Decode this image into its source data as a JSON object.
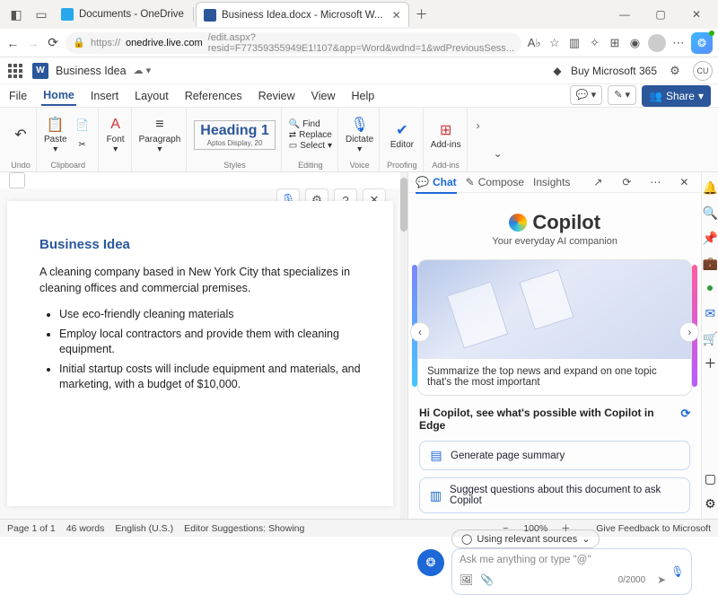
{
  "browser": {
    "tabs": [
      {
        "title": "Documents - OneDrive"
      },
      {
        "title": "Business Idea.docx - Microsoft W..."
      }
    ],
    "url_prefix": "https://",
    "url_domain": "onedrive.live.com",
    "url_path": "/edit.aspx?resid=F77359355949E1!107&app=Word&wdnd=1&wdPreviousSess...",
    "reading": "A♭"
  },
  "word_header": {
    "doc_name": "Business Idea",
    "buy": "Buy Microsoft 365",
    "account": "CU"
  },
  "menu": {
    "items": [
      "File",
      "Home",
      "Insert",
      "Layout",
      "References",
      "Review",
      "View",
      "Help"
    ],
    "active": "Home",
    "share": "Share"
  },
  "ribbon": {
    "undo": "Undo",
    "paste": "Paste",
    "clipboard": "Clipboard",
    "font": "Font",
    "paragraph": "Paragraph",
    "heading_title": "Heading 1",
    "heading_sub": "Aptos Display, 20",
    "styles": "Styles",
    "find": "Find",
    "replace": "Replace",
    "select": "Select",
    "editing": "Editing",
    "dictate": "Dictate",
    "voice": "Voice",
    "editor": "Editor",
    "proofing": "Proofing",
    "addins": "Add-ins",
    "addins_group": "Add-ins"
  },
  "document": {
    "title": "Business Idea",
    "para": "A cleaning company based in New York City that specializes in cleaning offices and commercial premises.",
    "bullets": [
      "Use eco-friendly cleaning materials",
      "Employ local contractors and provide them with cleaning equipment.",
      "Initial startup costs will include equipment and materials, and marketing, with a budget of $10,000."
    ]
  },
  "copilot": {
    "tabs": {
      "chat": "Chat",
      "compose": "Compose",
      "insights": "Insights"
    },
    "brand": "Copilot",
    "subtitle": "Your everyday AI companion",
    "card_text": "Summarize the top news and expand on one topic that's the most important",
    "hello": "Hi Copilot, see what's possible with Copilot in Edge",
    "suggest1": "Generate page summary",
    "suggest2": "Suggest questions about this document to ask Copilot",
    "sources": "Using relevant sources",
    "placeholder": "Ask me anything or type \"@\"",
    "counter": "0/2000"
  },
  "status": {
    "page": "Page 1 of 1",
    "words": "46 words",
    "lang": "English (U.S.)",
    "suggest": "Editor Suggestions: Showing",
    "zoom": "100%",
    "feedback": "Give Feedback to Microsoft"
  }
}
